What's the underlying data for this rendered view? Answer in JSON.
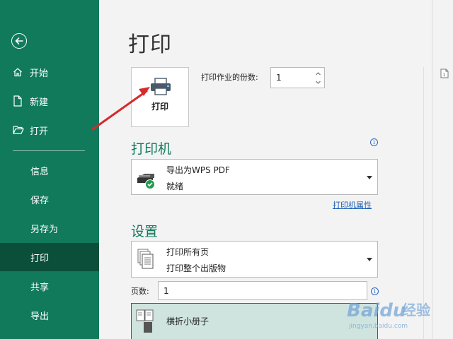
{
  "sidebar": {
    "items": [
      {
        "label": "开始",
        "icon": "home-icon"
      },
      {
        "label": "新建",
        "icon": "document-icon"
      },
      {
        "label": "打开",
        "icon": "folder-open-icon"
      },
      {
        "label": "信息"
      },
      {
        "label": "保存"
      },
      {
        "label": "另存为"
      },
      {
        "label": "打印",
        "active": true
      },
      {
        "label": "共享"
      },
      {
        "label": "导出"
      }
    ]
  },
  "main": {
    "title": "打印",
    "print_button_label": "打印",
    "copies_label": "打印作业的份数:",
    "copies_value": "1",
    "printer_section_title": "打印机",
    "printer_name": "导出为WPS PDF",
    "printer_status": "就绪",
    "printer_properties_link": "打印机属性",
    "settings_section_title": "设置",
    "print_range_title": "打印所有页",
    "print_range_desc": "打印整个出版物",
    "pages_label": "页数:",
    "pages_value": "1",
    "booklet_option": "横折小册子"
  },
  "watermark": {
    "brand": "Baidu",
    "text": "经验",
    "url": "jingyan.baidu.com"
  },
  "colors": {
    "sidebar": "#107a5b",
    "sidebar_active": "#0b4f3a",
    "accent": "#107a5b",
    "arrow": "#d42b2b"
  }
}
